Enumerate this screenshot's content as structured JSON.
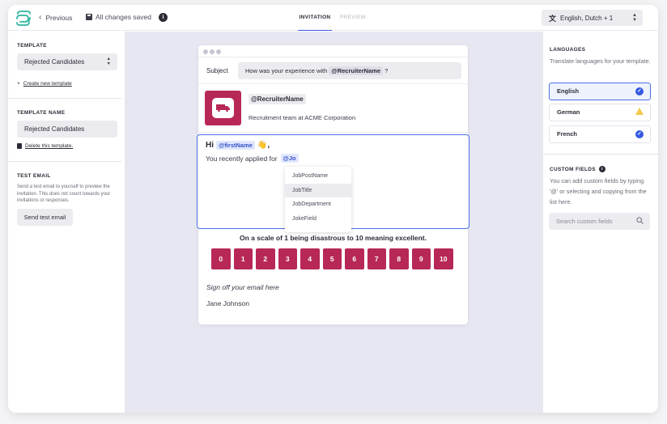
{
  "topbar": {
    "previous_label": "Previous",
    "saved_label": "All changes saved",
    "tabs": [
      {
        "label": "INVITATION",
        "active": true
      },
      {
        "label": "PREVIEW",
        "active": false
      }
    ],
    "language_select": "English, Dutch + 1"
  },
  "left": {
    "template_title": "TEMPLATE",
    "template_value": "Rejected Candidates",
    "create_link": "Create new template",
    "name_title": "TEMPLATE NAME",
    "name_value": "Rejected Candidates",
    "delete_link": "Delete this template.",
    "test_title": "TEST EMAIL",
    "test_desc": "Send a test email to yourself to preview the invitation. This does not count towards your invitations or responses.",
    "test_button": "Send test email"
  },
  "email": {
    "subject_label": "Subject",
    "subject_text": "How was your experience with",
    "subject_tag": "@RecruiterName",
    "subject_suffix": "?",
    "sender_tag": "@RecruiterName",
    "sender_role": "Recruitment team at ACME Corporation",
    "greeting": "Hi",
    "greeting_mention": "@firstName",
    "greeting_emoji": "👋",
    "greeting_suffix": ",",
    "applied_text": "You recently applied for",
    "applied_mention": "@Jo",
    "suggestions": [
      "JobPostName",
      "JobTitle",
      "JobDepartment",
      "JokeField"
    ],
    "scale_question": "On a scale of 1 being disastrous to 10 meaning excellent.",
    "scale": [
      "0",
      "1",
      "2",
      "3",
      "4",
      "5",
      "6",
      "7",
      "8",
      "9",
      "10"
    ],
    "signoff": "Sign off your email here",
    "signer": "Jane Johnson"
  },
  "right": {
    "languages_title": "LANGUAGES",
    "languages_desc": "Translate languages for your template.",
    "languages": [
      {
        "name": "English",
        "status": "check",
        "selected": true
      },
      {
        "name": "German",
        "status": "warning",
        "selected": false
      },
      {
        "name": "French",
        "status": "check",
        "selected": false
      }
    ],
    "custom_title": "CUSTOM FIELDS",
    "custom_desc": "You can add custom fields by typing '@' or selecting and copying from the list here.",
    "search_placeholder": "Search custom fields"
  },
  "colors": {
    "accent": "#3559e0",
    "brand": "#b72856",
    "warning": "#f2c94c"
  }
}
